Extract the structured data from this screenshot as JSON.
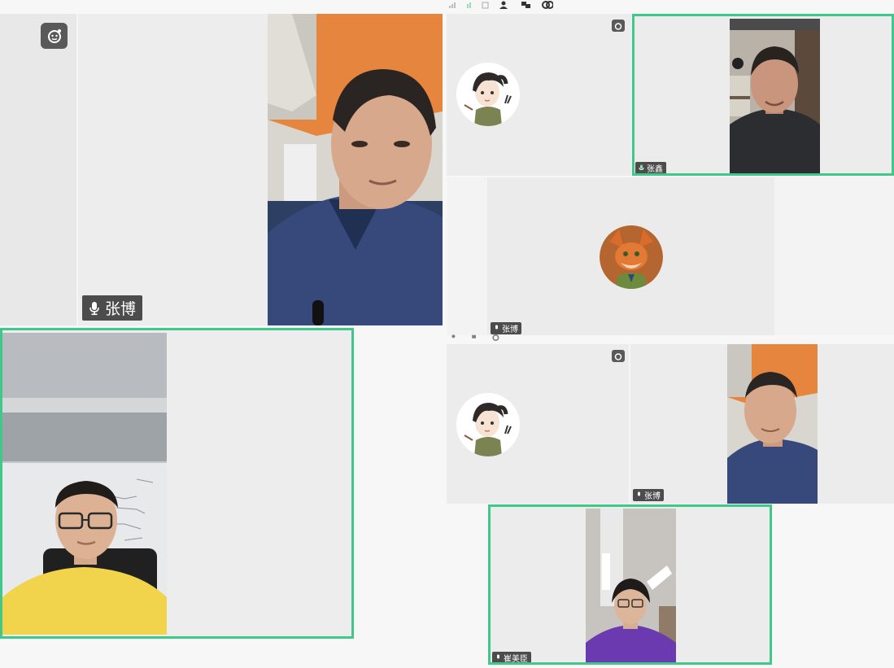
{
  "participants": {
    "main_top_left": {
      "name": "张博"
    },
    "right_top_active": {
      "name": "张鑫"
    },
    "right_middle": {
      "name": "张博"
    },
    "right_lower_middle": {
      "name": "张博"
    },
    "bottom_right_active": {
      "name": "崔美臣"
    }
  },
  "colors": {
    "active_border": "#3ec98a",
    "tile_bg": "#ececec",
    "tag_bg": "#282828",
    "badge_bg": "#595959"
  },
  "icons": [
    "microphone-icon",
    "emoji-face-icon",
    "signal-icon",
    "share-icon",
    "add-person-icon",
    "layout-icon",
    "settings-icon"
  ]
}
